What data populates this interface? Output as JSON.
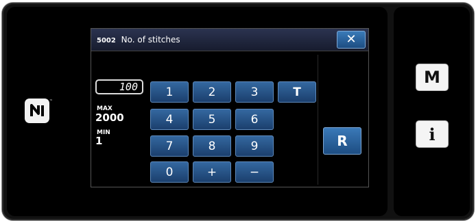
{
  "dialog": {
    "code": "5002",
    "title": "No. of stitches",
    "close_label": "✕"
  },
  "input": {
    "value": "100"
  },
  "limits": {
    "max_label": "MAX",
    "max_value": "2000",
    "min_label": "MIN",
    "min_value": "1"
  },
  "keypad": {
    "keys": [
      "1",
      "2",
      "3",
      "T",
      "4",
      "5",
      "6",
      "7",
      "8",
      "9",
      "0",
      "+",
      "−"
    ],
    "reset_label": "R"
  },
  "side_panel": {
    "mode_label": "M",
    "info_label": "i"
  },
  "icons": {
    "nfc": "nfc-icon",
    "close": "close-icon"
  },
  "colors": {
    "key_blue": "#2a5a92",
    "background": "#000000",
    "side_button": "#f4f4f4"
  }
}
